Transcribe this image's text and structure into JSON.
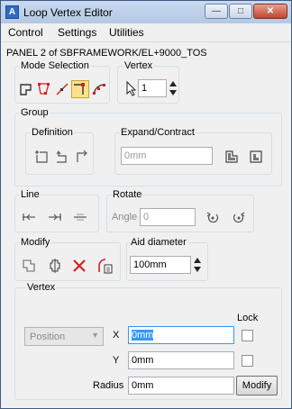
{
  "window": {
    "title": "Loop Vertex Editor"
  },
  "menu": [
    "Control",
    "Settings",
    "Utilities"
  ],
  "panel_title": "PANEL 2 of SBFRAMEWORK/EL+9000_TOS",
  "mode_selection": {
    "label": "Mode Selection"
  },
  "vertex": {
    "label": "Vertex",
    "value": "1"
  },
  "group": {
    "label": "Group",
    "definition_label": "Definition",
    "expand_label": "Expand/Contract",
    "expand_value": "0mm"
  },
  "line": {
    "label": "Line"
  },
  "rotate": {
    "label": "Rotate",
    "angle_label": "Angle",
    "angle_value": "0"
  },
  "modify": {
    "label": "Modify"
  },
  "aid_diameter": {
    "label": "Aid diameter",
    "value": "100mm"
  },
  "vertex_panel": {
    "label": "Vertex",
    "lock_label": "Lock",
    "position_option": "Position",
    "x_label": "X",
    "x_value": "0mm",
    "y_label": "Y",
    "y_value": "0mm",
    "radius_label": "Radius",
    "radius_value": "0mm",
    "modify_button": "Modify"
  },
  "icons": {
    "mode": [
      "vertex-square-icon",
      "vertex-polygon-icon",
      "vertex-line-icon",
      "vertex-corner-icon",
      "vertex-curve-icon"
    ],
    "definition": [
      "definition-insert-icon",
      "definition-step-in-icon",
      "definition-step-out-icon"
    ],
    "expand": [
      "expand-icon",
      "contract-icon"
    ],
    "line": [
      "line-left-icon",
      "line-right-icon",
      "line-center-icon"
    ],
    "rotate": [
      "rotate-ccw-icon",
      "rotate-cw-icon"
    ],
    "modify": [
      "modify-shape-icon",
      "modify-split-icon",
      "delete-icon",
      "modify-arc-icon"
    ]
  },
  "colors": {
    "active_tool": "#ffe38a",
    "title_bar": "#b3c8e4",
    "accent_red": "#d42020",
    "icon_blue": "#1a5fb4"
  }
}
